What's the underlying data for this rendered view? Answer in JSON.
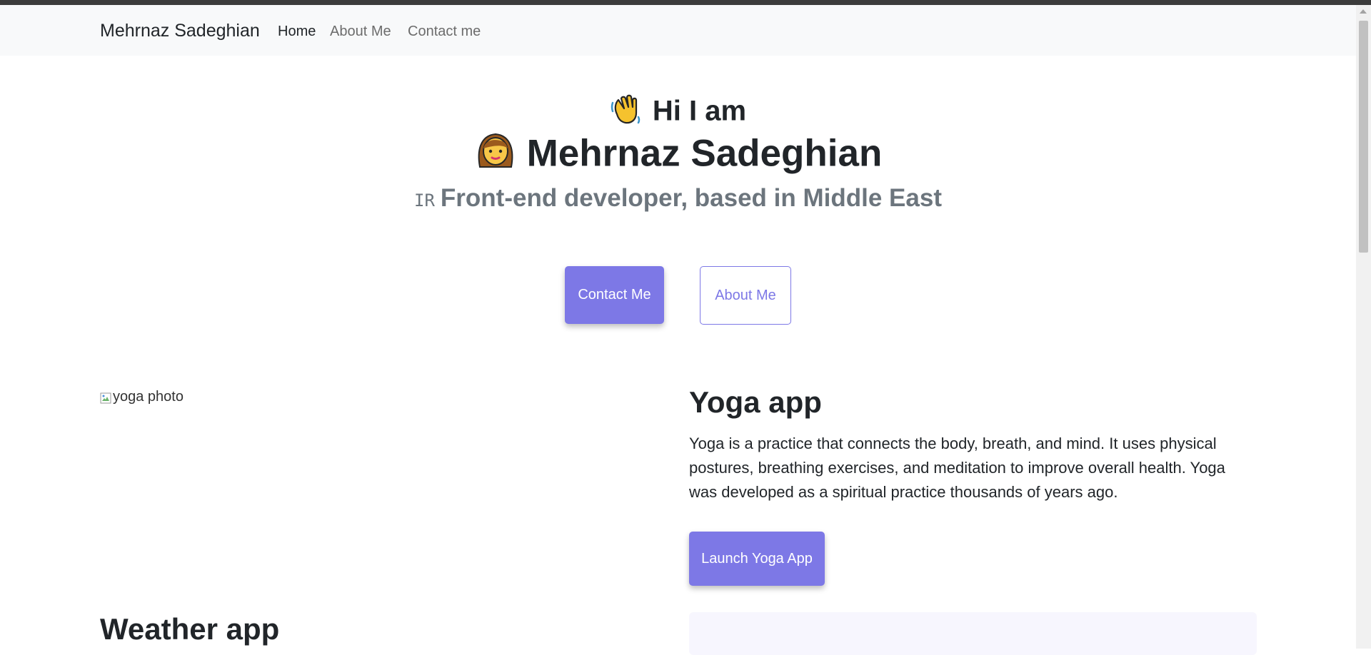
{
  "navbar": {
    "brand": "Mehrnaz Sadeghian",
    "links": [
      {
        "label": "Home",
        "active": true
      },
      {
        "label": "About Me",
        "active": false
      },
      {
        "label": "Contact me",
        "active": false
      }
    ]
  },
  "hero": {
    "greeting_icon": "waving-hand-emoji",
    "greeting": "Hi I am",
    "name_icon": "woman-emoji",
    "name": "Mehrnaz Sadeghian",
    "flag_text": "IR",
    "role": "Front-end developer, based in Middle East",
    "contact_button": "Contact Me",
    "about_button": "About Me"
  },
  "projects": [
    {
      "image_alt": "yoga photo",
      "title": "Yoga app",
      "description": "Yoga is a practice that connects the body, breath, and mind. It uses physical postures, breathing exercises, and meditation to improve overall health. Yoga was developed as a spiritual practice thousands of years ago.",
      "button": "Launch Yoga App"
    },
    {
      "title": "Weather app"
    }
  ],
  "colors": {
    "accent": "#7d78e6",
    "navbar_bg": "#f8f9fa",
    "muted_text": "#6c757d",
    "panel_bg": "#f7f6fe"
  }
}
